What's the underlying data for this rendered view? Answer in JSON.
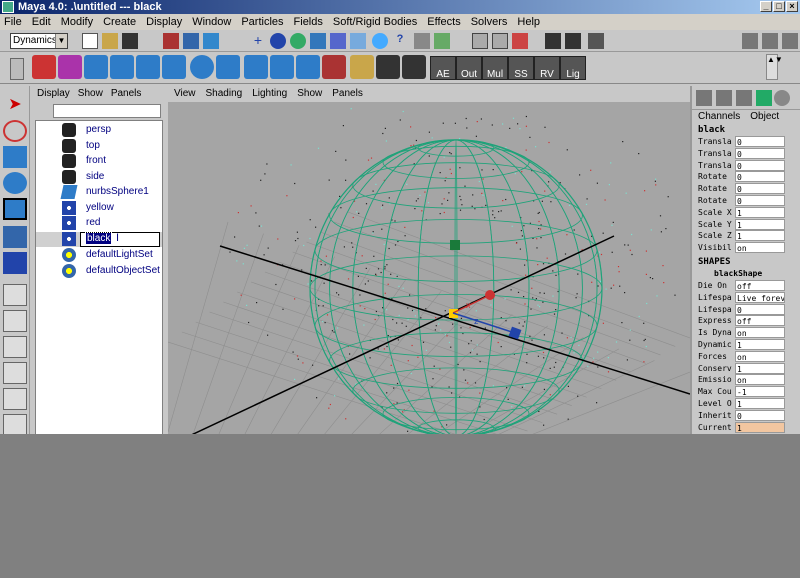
{
  "window": {
    "title": "Maya 4.0: .\\untitled   ---   black"
  },
  "menubar": {
    "items": [
      "File",
      "Edit",
      "Modify",
      "Create",
      "Display",
      "Window",
      "Particles",
      "Fields",
      "Soft/Rigid Bodies",
      "Effects",
      "Solvers",
      "Help"
    ]
  },
  "toolbar": {
    "mode": "Dynamics",
    "sel_label": "sel",
    "sel_value": ""
  },
  "shelf": {
    "labels": [
      "AE",
      "Out",
      "Mul",
      "SS",
      "RV",
      "Lig"
    ]
  },
  "outliner": {
    "menu": [
      "Display",
      "Show",
      "Panels"
    ],
    "filter_value": "",
    "items": [
      {
        "label": "persp",
        "icon": "camera-icon"
      },
      {
        "label": "top",
        "icon": "camera-icon"
      },
      {
        "label": "front",
        "icon": "camera-icon"
      },
      {
        "label": "side",
        "icon": "camera-icon"
      },
      {
        "label": "nurbsSphere1",
        "icon": "nurbs-sphere-icon"
      },
      {
        "label": "yellow",
        "icon": "particle-icon"
      },
      {
        "label": "red",
        "icon": "particle-icon"
      },
      {
        "label": "black",
        "icon": "particle-icon",
        "selected": true
      },
      {
        "label": "defaultLightSet",
        "icon": "set-icon"
      },
      {
        "label": "defaultObjectSet",
        "icon": "set-icon"
      }
    ]
  },
  "viewport": {
    "menu": [
      "View",
      "Shading",
      "Lighting",
      "Show",
      "Panels"
    ]
  },
  "channelbox": {
    "tabs": [
      "Channels",
      "Object"
    ],
    "object_name": "black",
    "transform_rows": [
      {
        "name": "Transla",
        "value": "0"
      },
      {
        "name": "Transla",
        "value": "0"
      },
      {
        "name": "Transla",
        "value": "0"
      },
      {
        "name": "Rotate",
        "value": "0"
      },
      {
        "name": "Rotate",
        "value": "0"
      },
      {
        "name": "Rotate",
        "value": "0"
      },
      {
        "name": "Scale X",
        "value": "1"
      },
      {
        "name": "Scale Y",
        "value": "1"
      },
      {
        "name": "Scale Z",
        "value": "1"
      },
      {
        "name": "Visibil",
        "value": "on"
      }
    ],
    "shapes_header": "SHAPES",
    "shape_name": "blackShape",
    "shape_rows": [
      {
        "name": "Die On",
        "value": "off"
      },
      {
        "name": "Lifespa",
        "value": "Live forev"
      },
      {
        "name": "Lifespa",
        "value": "0"
      },
      {
        "name": "Express",
        "value": "off"
      },
      {
        "name": "Is Dyna",
        "value": "on"
      },
      {
        "name": "Dynamic",
        "value": "1"
      },
      {
        "name": "Forces",
        "value": "on"
      },
      {
        "name": "Conserv",
        "value": "1"
      },
      {
        "name": "Emissio",
        "value": "on"
      },
      {
        "name": "Max Cou",
        "value": "-1"
      },
      {
        "name": "Level O",
        "value": "1"
      },
      {
        "name": "Inherit",
        "value": "0"
      },
      {
        "name": "Current",
        "value": "1",
        "highlight": true
      }
    ]
  },
  "colors": {
    "title_start": "#0a246a",
    "title_end": "#a6caf0",
    "wireframe": "#1fa37a",
    "selection": "#000080",
    "highlight_cell": "#f2c6a0"
  }
}
